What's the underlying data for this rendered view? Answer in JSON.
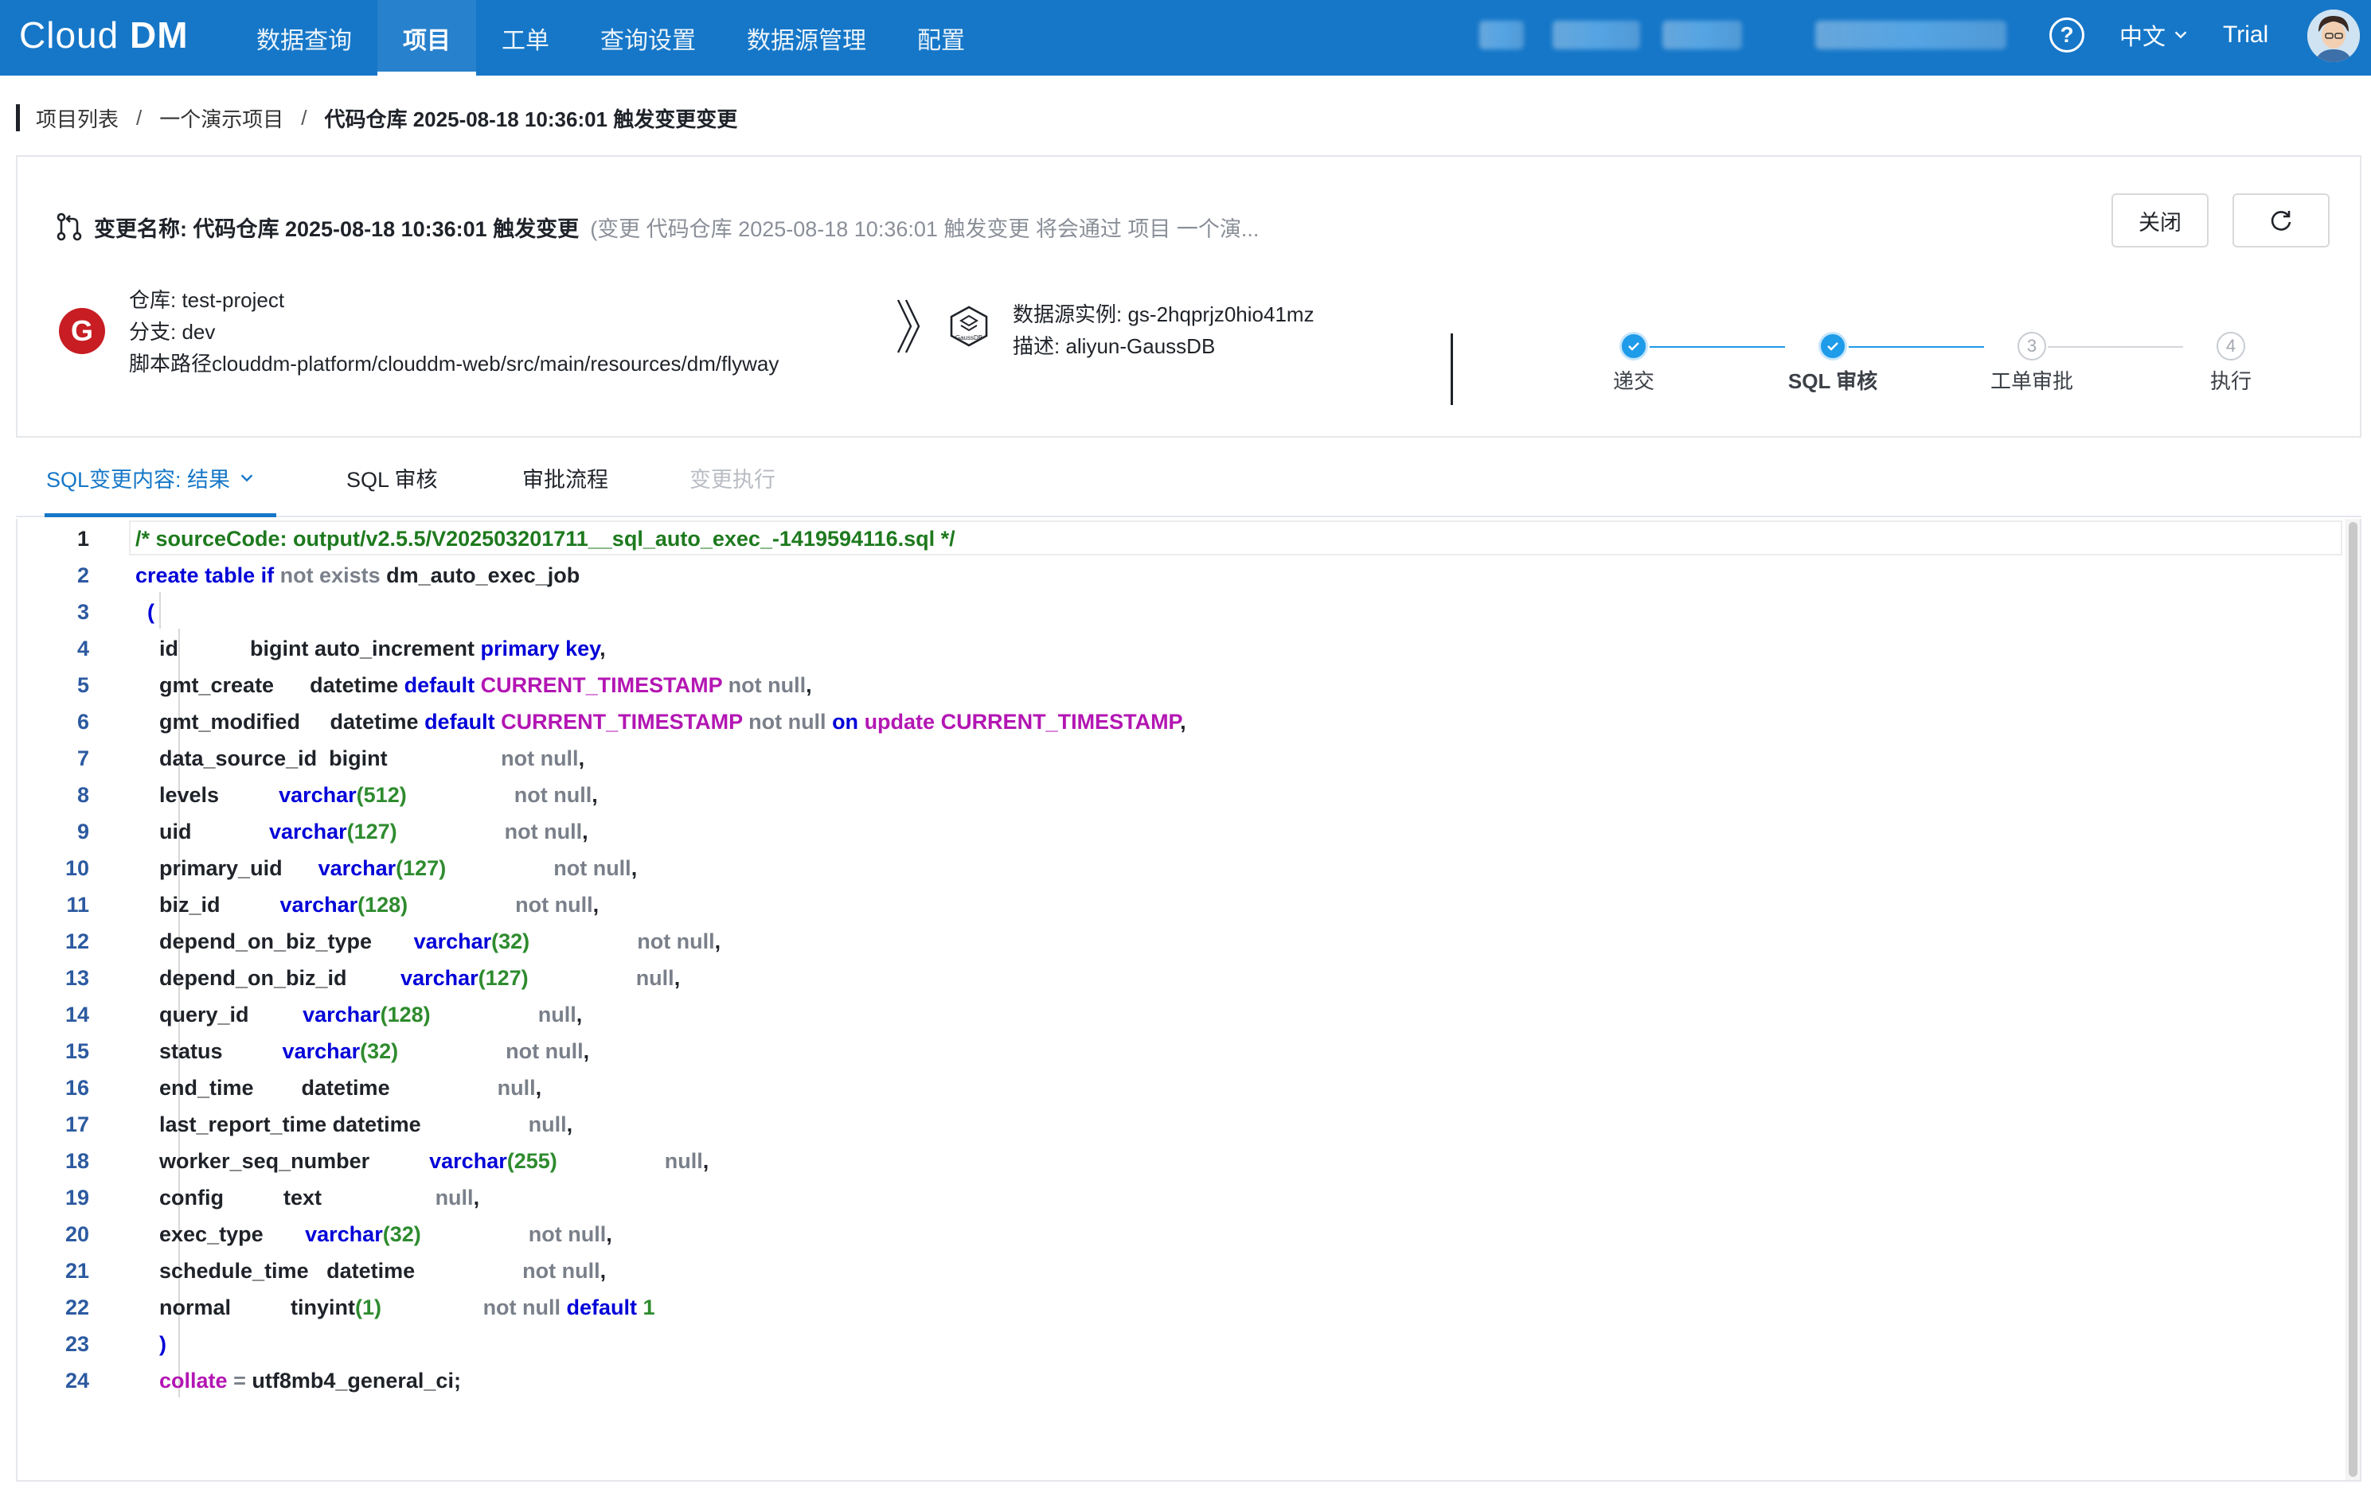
{
  "app": {
    "logo_main": "Cloud",
    "logo_suffix": "DM",
    "nav": [
      {
        "label": "数据查询",
        "active": false
      },
      {
        "label": "项目",
        "active": true
      },
      {
        "label": "工单",
        "active": false
      },
      {
        "label": "查询设置",
        "active": false
      },
      {
        "label": "数据源管理",
        "active": false
      },
      {
        "label": "配置",
        "active": false
      }
    ],
    "help_icon": "?",
    "language": "中文",
    "plan": "Trial",
    "brand_color": "#1677c8"
  },
  "breadcrumb": [
    {
      "label": "项目列表"
    },
    {
      "label": "一个演示项目"
    },
    {
      "label": "代码仓库 2025-08-18 10:36:01 触发变更变更"
    }
  ],
  "change": {
    "title": "变更名称: 代码仓库 2025-08-18 10:36:01 触发变更",
    "description": "(变更 代码仓库 2025-08-18 10:36:01 触发变更 将会通过 项目 一个演...",
    "close_label": "关闭",
    "repo": {
      "repo_line": "仓库: test-project",
      "branch_line": "分支: dev",
      "path_line": "脚本路径clouddm-platform/clouddm-web/src/main/resources/dm/flyway"
    },
    "datasource": {
      "instance_line": "数据源实例: gs-2hqprjz0hio41mz",
      "desc_line": "描述: aliyun-GaussDB",
      "logo_text": "GaussDB"
    },
    "steps": [
      {
        "label": "递交",
        "status": "done"
      },
      {
        "label": "SQL 审核",
        "status": "done"
      },
      {
        "label": "工单审批",
        "status": "todo",
        "index": "3"
      },
      {
        "label": "执行",
        "status": "todo",
        "index": "4"
      }
    ]
  },
  "tabs": [
    {
      "label": "SQL变更内容: 结果",
      "active": true
    },
    {
      "label": "SQL 审核",
      "active": false
    },
    {
      "label": "审批流程",
      "active": false
    },
    {
      "label": "变更执行",
      "disabled": true
    }
  ],
  "editor": {
    "lines": [
      [
        [
          "c",
          "/* sourceCode: output/v2.5.5/V202503201711__sql_auto_exec_-1419594116.sql */"
        ]
      ],
      [
        [
          "k",
          "create table if "
        ],
        [
          "g",
          "not exists "
        ],
        [
          "",
          "dm_auto_exec_job"
        ]
      ],
      [
        [
          "",
          "  "
        ],
        [
          "k",
          "("
        ]
      ],
      [
        [
          "",
          "    id            bigint auto_increment "
        ],
        [
          "k",
          "primary key"
        ],
        [
          "",
          ","
        ]
      ],
      [
        [
          "",
          "    gmt_create      datetime "
        ],
        [
          "k",
          "default "
        ],
        [
          "m",
          "CURRENT_TIMESTAMP "
        ],
        [
          "g",
          "not null"
        ],
        [
          "",
          ","
        ]
      ],
      [
        [
          "",
          "    gmt_modified     datetime "
        ],
        [
          "k",
          "default "
        ],
        [
          "m",
          "CURRENT_TIMESTAMP "
        ],
        [
          "g",
          "not null "
        ],
        [
          "k",
          "on "
        ],
        [
          "m",
          "update CURRENT_TIMESTAMP"
        ],
        [
          "",
          ","
        ]
      ],
      [
        [
          "",
          "    data_source_id  bigint                   "
        ],
        [
          "g",
          "not null"
        ],
        [
          "",
          ","
        ]
      ],
      [
        [
          "",
          "    levels          "
        ],
        [
          "t",
          "varchar"
        ],
        [
          "n",
          "(512)"
        ],
        [
          "",
          "                  "
        ],
        [
          "g",
          "not null"
        ],
        [
          "",
          ","
        ]
      ],
      [
        [
          "",
          "    uid             "
        ],
        [
          "t",
          "varchar"
        ],
        [
          "n",
          "(127)"
        ],
        [
          "",
          "                  "
        ],
        [
          "g",
          "not null"
        ],
        [
          "",
          ","
        ]
      ],
      [
        [
          "",
          "    primary_uid      "
        ],
        [
          "t",
          "varchar"
        ],
        [
          "n",
          "(127)"
        ],
        [
          "",
          "                  "
        ],
        [
          "g",
          "not null"
        ],
        [
          "",
          ","
        ]
      ],
      [
        [
          "",
          "    biz_id          "
        ],
        [
          "t",
          "varchar"
        ],
        [
          "n",
          "(128)"
        ],
        [
          "",
          "                  "
        ],
        [
          "g",
          "not null"
        ],
        [
          "",
          ","
        ]
      ],
      [
        [
          "",
          "    depend_on_biz_type       "
        ],
        [
          "t",
          "varchar"
        ],
        [
          "n",
          "(32)"
        ],
        [
          "",
          "                  "
        ],
        [
          "g",
          "not null"
        ],
        [
          "",
          ","
        ]
      ],
      [
        [
          "",
          "    depend_on_biz_id         "
        ],
        [
          "t",
          "varchar"
        ],
        [
          "n",
          "(127)"
        ],
        [
          "",
          "                  "
        ],
        [
          "g",
          "null"
        ],
        [
          "",
          ","
        ]
      ],
      [
        [
          "",
          "    query_id         "
        ],
        [
          "t",
          "varchar"
        ],
        [
          "n",
          "(128)"
        ],
        [
          "",
          "                  "
        ],
        [
          "g",
          "null"
        ],
        [
          "",
          ","
        ]
      ],
      [
        [
          "",
          "    status          "
        ],
        [
          "t",
          "varchar"
        ],
        [
          "n",
          "(32)"
        ],
        [
          "",
          "                  "
        ],
        [
          "g",
          "not null"
        ],
        [
          "",
          ","
        ]
      ],
      [
        [
          "",
          "    end_time        datetime                  "
        ],
        [
          "g",
          "null"
        ],
        [
          "",
          ","
        ]
      ],
      [
        [
          "",
          "    last_report_time datetime                  "
        ],
        [
          "g",
          "null"
        ],
        [
          "",
          ","
        ]
      ],
      [
        [
          "",
          "    worker_seq_number          "
        ],
        [
          "t",
          "varchar"
        ],
        [
          "n",
          "(255)"
        ],
        [
          "",
          "                  "
        ],
        [
          "g",
          "null"
        ],
        [
          "",
          ","
        ]
      ],
      [
        [
          "",
          "    config          text                   "
        ],
        [
          "g",
          "null"
        ],
        [
          "",
          ","
        ]
      ],
      [
        [
          "",
          "    exec_type       "
        ],
        [
          "t",
          "varchar"
        ],
        [
          "n",
          "(32)"
        ],
        [
          "",
          "                  "
        ],
        [
          "g",
          "not null"
        ],
        [
          "",
          ","
        ]
      ],
      [
        [
          "",
          "    schedule_time   datetime                  "
        ],
        [
          "g",
          "not null"
        ],
        [
          "",
          ","
        ]
      ],
      [
        [
          "",
          "    normal          tinyint"
        ],
        [
          "n",
          "(1)"
        ],
        [
          "",
          "                 "
        ],
        [
          "g",
          "not null "
        ],
        [
          "k",
          "default "
        ],
        [
          "n",
          "1"
        ]
      ],
      [
        [
          "",
          "    "
        ],
        [
          "k",
          ")"
        ]
      ],
      [
        [
          "",
          "    "
        ],
        [
          "m",
          "collate "
        ],
        [
          "g",
          "= "
        ],
        [
          "",
          "utf8mb4_general_ci;"
        ]
      ]
    ]
  }
}
